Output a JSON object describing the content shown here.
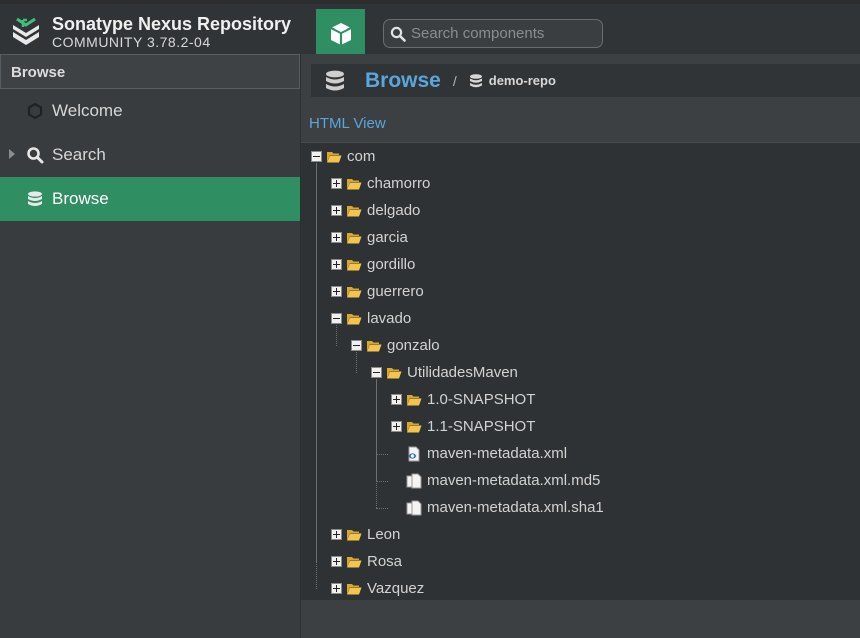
{
  "app": {
    "name": "Sonatype Nexus Repository",
    "version": "COMMUNITY 3.78.2-04"
  },
  "header": {
    "search_placeholder": "Search components"
  },
  "sidebar": {
    "title": "Browse",
    "items": [
      {
        "label": "Welcome",
        "icon": "hexagon-icon"
      },
      {
        "label": "Search",
        "icon": "search-icon"
      },
      {
        "label": "Browse",
        "icon": "database-icon",
        "active": true
      }
    ]
  },
  "breadcrumb": {
    "title": "Browse",
    "separator": "/",
    "repo": "demo-repo"
  },
  "html_view_label": "HTML View",
  "tree": [
    {
      "label": "com",
      "depth": 0,
      "type": "folder",
      "expanded": true
    },
    {
      "label": "chamorro",
      "depth": 1,
      "type": "folder",
      "expanded": false
    },
    {
      "label": "delgado",
      "depth": 1,
      "type": "folder",
      "expanded": false
    },
    {
      "label": "garcia",
      "depth": 1,
      "type": "folder",
      "expanded": false
    },
    {
      "label": "gordillo",
      "depth": 1,
      "type": "folder",
      "expanded": false
    },
    {
      "label": "guerrero",
      "depth": 1,
      "type": "folder",
      "expanded": false
    },
    {
      "label": "lavado",
      "depth": 1,
      "type": "folder",
      "expanded": true
    },
    {
      "label": "gonzalo",
      "depth": 2,
      "type": "folder",
      "expanded": true
    },
    {
      "label": "UtilidadesMaven",
      "depth": 3,
      "type": "folder",
      "expanded": true
    },
    {
      "label": "1.0-SNAPSHOT",
      "depth": 4,
      "type": "folder",
      "expanded": false
    },
    {
      "label": "1.1-SNAPSHOT",
      "depth": 4,
      "type": "folder",
      "expanded": false
    },
    {
      "label": "maven-metadata.xml",
      "depth": 4,
      "type": "xml-file"
    },
    {
      "label": "maven-metadata.xml.md5",
      "depth": 4,
      "type": "file"
    },
    {
      "label": "maven-metadata.xml.sha1",
      "depth": 4,
      "type": "file"
    },
    {
      "label": "Leon",
      "depth": 1,
      "type": "folder",
      "expanded": false
    },
    {
      "label": "Rosa",
      "depth": 1,
      "type": "folder",
      "expanded": false
    },
    {
      "label": "Vazquez",
      "depth": 1,
      "type": "folder",
      "expanded": false
    }
  ],
  "colors": {
    "accent_green": "#2f8f62",
    "link_blue": "#5aa5dc",
    "folder_yellow": "#f3c44e"
  }
}
